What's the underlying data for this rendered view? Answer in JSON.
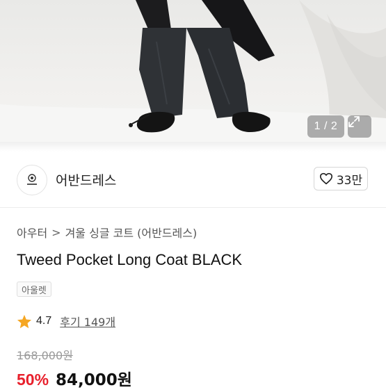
{
  "gallery": {
    "counter": "1 / 2",
    "expand_icon": "expand-icon"
  },
  "brand": {
    "name": "어반드레스",
    "logo_icon": "brand-logo-icon",
    "like_count": "33만",
    "like_icon": "heart-icon"
  },
  "product": {
    "breadcrumb": [
      "아우터",
      "겨울 싱글 코트 (어반드레스)"
    ],
    "title": "Tweed Pocket Long Coat BLACK",
    "tag": "아울렛",
    "rating": "4.7",
    "review_label": "후기 149개",
    "original_price": "168,000원",
    "discount": "50%",
    "sale_price": "84,000원"
  },
  "colors": {
    "discount": "#e8202c",
    "star": "#f5a623"
  }
}
